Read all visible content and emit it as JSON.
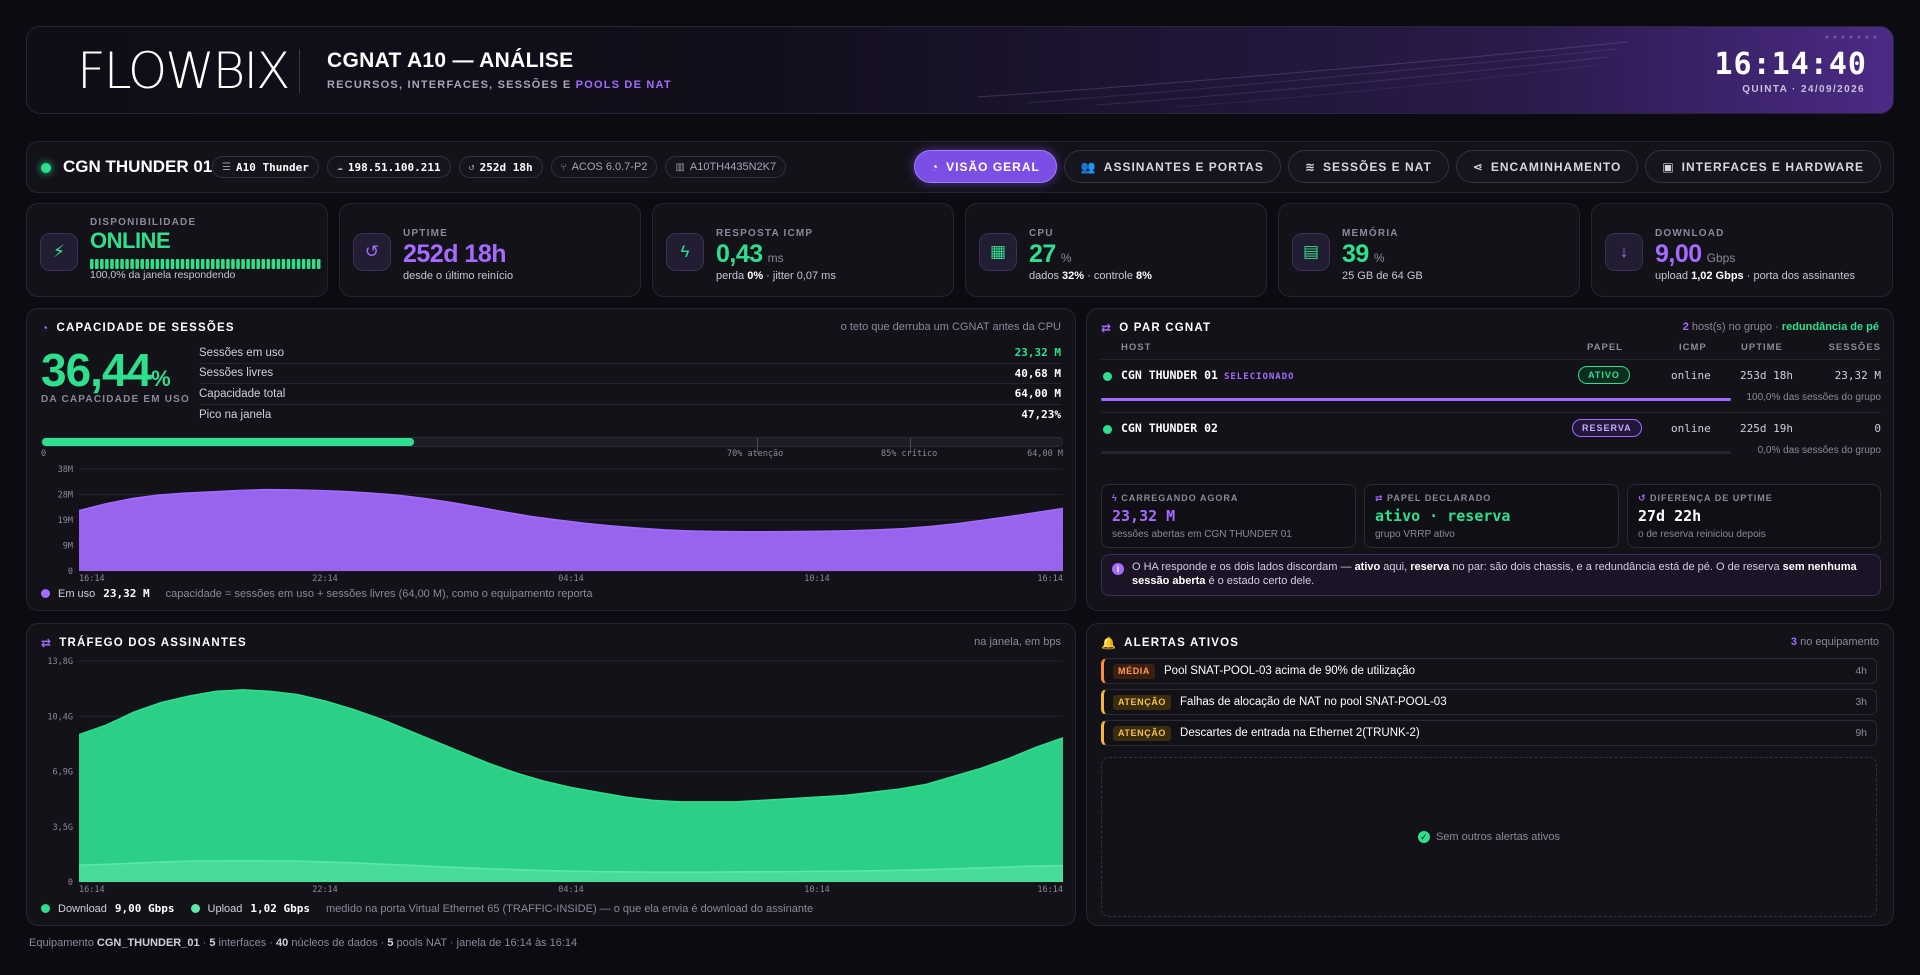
{
  "header": {
    "logo": "FLOWBIX",
    "title": "CGNAT A10 — ANÁLISE",
    "subtitle_prefix": "RECURSOS, INTERFACES, SESSÕES E ",
    "subtitle_accent": "POOLS DE NAT",
    "clock": "16:14:40",
    "date": "QUINTA · 24/09/2026"
  },
  "device": {
    "name": "CGN THUNDER 01",
    "chips": [
      "A10 Thunder",
      "198.51.100.211",
      "252d 18h",
      "ACOS 6.0.7-P2",
      "A10TH4435N2K7"
    ],
    "tabs": [
      {
        "label": "VISÃO GERAL",
        "icon": "gauge-icon",
        "active": true
      },
      {
        "label": "ASSINANTES E PORTAS",
        "icon": "users-icon",
        "active": false
      },
      {
        "label": "SESSÕES E NAT",
        "icon": "layers-icon",
        "active": false
      },
      {
        "label": "ENCAMINHAMENTO",
        "icon": "share-icon",
        "active": false
      },
      {
        "label": "INTERFACES E HARDWARE",
        "icon": "chip-icon",
        "active": false
      }
    ]
  },
  "kpis": {
    "availability": {
      "label": "DISPONIBILIDADE",
      "value": "ONLINE",
      "sub": "100,0% da janela respondendo",
      "level": 1.0
    },
    "uptime": {
      "label": "UPTIME",
      "value": "252d 18h",
      "sub": "desde o último reinício"
    },
    "icmp": {
      "label": "RESPOSTA ICMP",
      "value": "0,43",
      "unit": "ms",
      "sub_a": "perda ",
      "sub_b": "0%",
      "sub_c": " · jitter 0,07 ms"
    },
    "cpu": {
      "label": "CPU",
      "value": "27",
      "unit": "%",
      "sub_a": "dados ",
      "sub_b": "32%",
      "sub_c": " · controle ",
      "sub_d": "8%"
    },
    "memory": {
      "label": "MEMÓRIA",
      "value": "39",
      "unit": "%",
      "sub": "25 GB de 64 GB"
    },
    "download": {
      "label": "DOWNLOAD",
      "value": "9,00",
      "unit": "Gbps",
      "sub_a": "upload ",
      "sub_b": "1,02 Gbps",
      "sub_c": " · porta dos assinantes"
    }
  },
  "sessions": {
    "title": "CAPACIDADE DE SESSÕES",
    "note": "o teto que derruba um CGNAT antes da CPU",
    "big": "36,44",
    "big_unit": "%",
    "big_label": "DA CAPACIDADE EM USO",
    "rows": [
      {
        "label": "Sessões em uso",
        "value": "23,32 M"
      },
      {
        "label": "Sessões livres",
        "value": "40,68 M"
      },
      {
        "label": "Capacidade total",
        "value": "64,00 M"
      },
      {
        "label": "Pico na janela",
        "value": "47,23%"
      }
    ],
    "bar_fill_pct": 36.44,
    "bar_labels": {
      "min": "0",
      "warn": "70% atenção",
      "crit": "85% crítico",
      "max": "64,00 M"
    },
    "legend_label": "Em uso",
    "legend_value": "23,32 M",
    "legend_note": "capacidade = sessões em uso + sessões livres (64,00 M), como o equipamento reporta"
  },
  "pair": {
    "title": "O PAR CGNAT",
    "note_count": "2",
    "note_text": " host(s) no grupo · ",
    "note_accent": "redundância de pé",
    "headers": [
      "HOST",
      "PAPEL",
      "ICMP",
      "UPTIME",
      "SESSÕES"
    ],
    "rows": [
      {
        "host": "CGN THUNDER 01",
        "selected": "SELECIONADO",
        "role": "ATIVO",
        "icmp": "online",
        "uptime": "253d 18h",
        "sessions": "23,32 M",
        "share_pct": 100,
        "share_label": "100,0% das sessões do grupo"
      },
      {
        "host": "CGN THUNDER 02",
        "selected": "",
        "role": "RESERVA",
        "icmp": "online",
        "uptime": "225d 19h",
        "sessions": "0",
        "share_pct": 0,
        "share_label": "0,0% das sessões do grupo"
      }
    ],
    "cards": [
      {
        "label": "CARREGANDO AGORA",
        "value": "23,32 M",
        "sub": "sessões abertas em CGN THUNDER 01"
      },
      {
        "label": "PAPEL DECLARADO",
        "value": "ativo · reserva",
        "sub": "grupo VRRP ativo"
      },
      {
        "label": "DIFERENÇA DE UPTIME",
        "value": "27d 22h",
        "sub": "o de reserva reiniciou depois"
      }
    ],
    "info": {
      "t1": "O HA responde e os dois lados discordam — ",
      "b1": "ativo",
      "t2": " aqui, ",
      "b2": "reserva",
      "t3": " no par: são dois chassis, e a redundância está de pé. O de reserva ",
      "b3": "sem nenhuma sessão aberta",
      "t4": " é o estado certo dele."
    }
  },
  "traffic": {
    "title": "TRÁFEGO DOS ASSINANTES",
    "note": "na janela, em bps",
    "legend_dl": "Download",
    "legend_dl_val": "9,00 Gbps",
    "legend_ul": "Upload",
    "legend_ul_val": "1,02 Gbps",
    "legend_note": "medido na porta Virtual Ethernet 65 (TRAFFIC-INSIDE) — o que ela envia é download do assinante"
  },
  "alerts": {
    "title": "ALERTAS ATIVOS",
    "note_count": "3",
    "note_text": " no equipamento",
    "items": [
      {
        "level": "MÉDIA",
        "text": "Pool SNAT-POOL-03 acima de 90% de utilização",
        "time": "4h"
      },
      {
        "level": "ATENÇÃO",
        "text": "Falhas de alocação de NAT no pool SNAT-POOL-03",
        "time": "3h"
      },
      {
        "level": "ATENÇÃO",
        "text": "Descartes de entrada na Ethernet 2(TRUNK-2)",
        "time": "9h"
      }
    ],
    "empty": "Sem outros alertas ativos"
  },
  "footer": {
    "t1": "Equipamento ",
    "b1": "CGN_THUNDER_01",
    "t2": " · ",
    "b2": "5",
    "t3": " interfaces · ",
    "b3": "40",
    "t4": " núcleos de dados · ",
    "b4": "5",
    "t5": " pools NAT · janela de 16:14 às 16:14"
  },
  "colors": {
    "accent": "#a56bff",
    "green": "#2ee08e",
    "warn": "#ff8a3d",
    "attention": "#f5b83d"
  },
  "chart_data": [
    {
      "type": "area",
      "title": "CAPACIDADE DE SESSÕES",
      "x_ticks": [
        "16:14",
        "22:14",
        "04:14",
        "10:14",
        "16:14"
      ],
      "y_ticks": [
        "0",
        "9M",
        "19M",
        "28M",
        "38M"
      ],
      "ylim": [
        0,
        38
      ],
      "series": [
        {
          "name": "Em uso",
          "color": "#a56bff",
          "values": [
            22.5,
            25.0,
            27.0,
            28.3,
            29.0,
            29.5,
            30.0,
            30.3,
            30.2,
            30.0,
            29.6,
            29.0,
            28.2,
            27.0,
            25.5,
            23.8,
            22.0,
            20.3,
            19.0,
            17.8,
            16.8,
            16.0,
            15.3,
            14.9,
            14.7,
            14.6,
            14.6,
            14.7,
            14.8,
            15.0,
            15.3,
            15.8,
            16.6,
            17.6,
            18.9,
            20.3,
            21.8,
            23.3
          ]
        }
      ],
      "grid": true
    },
    {
      "type": "area",
      "title": "TRÁFEGO DOS ASSINANTES",
      "x_ticks": [
        "16:14",
        "22:14",
        "04:14",
        "10:14",
        "16:14"
      ],
      "y_ticks": [
        "0",
        "3,5G",
        "6,9G",
        "10,4G",
        "13,8G"
      ],
      "ylim": [
        0,
        13.8
      ],
      "series": [
        {
          "name": "Download",
          "color": "#2ee08e",
          "values": [
            9.2,
            9.8,
            10.6,
            11.2,
            11.6,
            11.9,
            12.0,
            11.9,
            11.7,
            11.3,
            10.8,
            10.2,
            9.5,
            8.8,
            8.1,
            7.4,
            6.8,
            6.3,
            5.9,
            5.6,
            5.3,
            5.1,
            5.0,
            5.0,
            5.0,
            5.1,
            5.2,
            5.3,
            5.4,
            5.6,
            5.8,
            6.1,
            6.6,
            7.1,
            7.7,
            8.4,
            9.0
          ]
        },
        {
          "name": "Upload",
          "color": "#5ee8a6",
          "values": [
            1.05,
            1.1,
            1.18,
            1.25,
            1.3,
            1.32,
            1.33,
            1.32,
            1.3,
            1.26,
            1.2,
            1.12,
            1.05,
            0.97,
            0.9,
            0.83,
            0.77,
            0.72,
            0.68,
            0.65,
            0.63,
            0.62,
            0.62,
            0.62,
            0.63,
            0.64,
            0.65,
            0.66,
            0.68,
            0.7,
            0.73,
            0.77,
            0.82,
            0.88,
            0.94,
            1.0,
            1.02
          ]
        }
      ],
      "grid": true
    }
  ]
}
